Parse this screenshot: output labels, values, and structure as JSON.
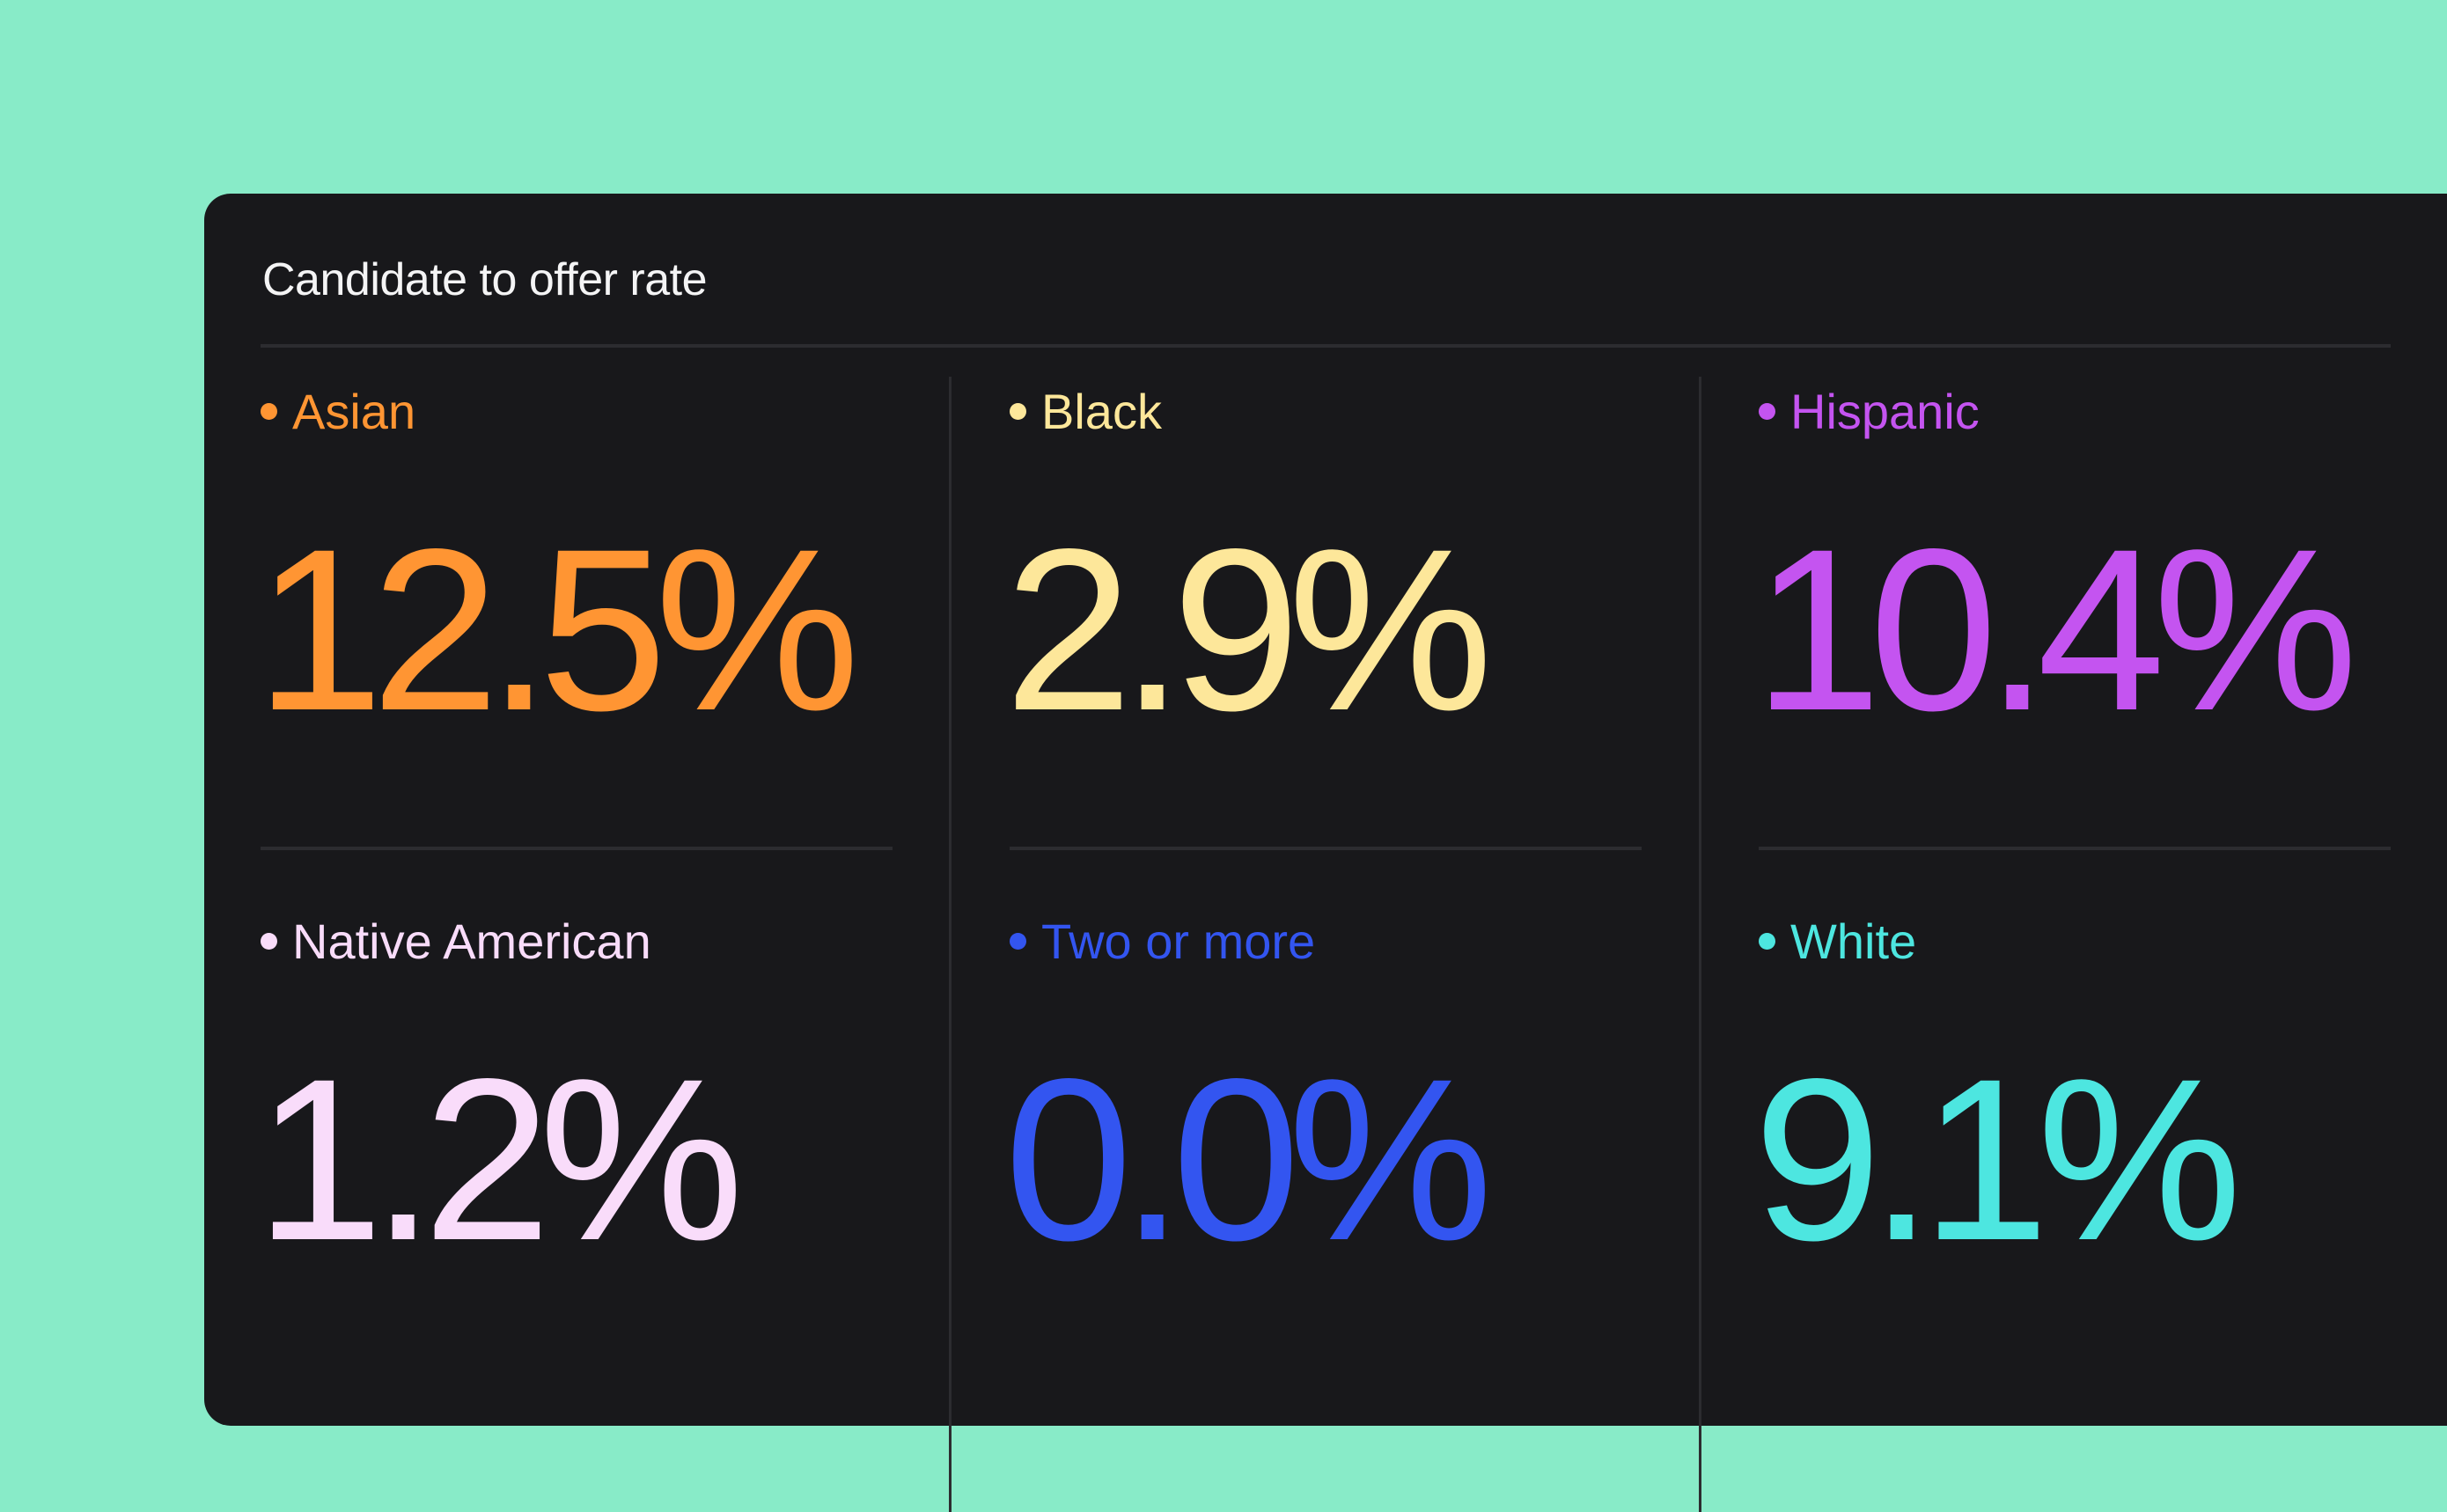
{
  "widget": {
    "title": "Candidate to offer rate",
    "metrics": [
      {
        "label": "Asian",
        "value": "12.5%",
        "color": "#ff9533"
      },
      {
        "label": "Black",
        "value": "2.9%",
        "color": "#fde79a"
      },
      {
        "label": "Hispanic",
        "value": "10.4%",
        "color": "#c454f0"
      },
      {
        "label": "Native American",
        "value": "1.2%",
        "color": "#f9dcfa"
      },
      {
        "label": "Two or more",
        "value": "0.0%",
        "color": "#3355f0"
      },
      {
        "label": "White",
        "value": "9.1%",
        "color": "#4de6e0"
      }
    ]
  }
}
